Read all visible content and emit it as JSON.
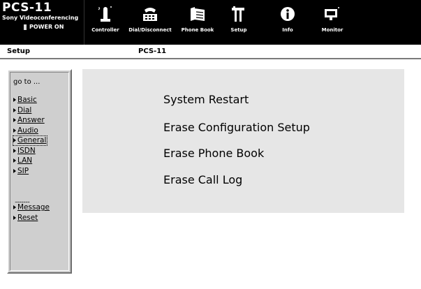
{
  "header": {
    "brand_title": "PCS-11",
    "brand_subtitle": "Sony Videoconferencing",
    "power_status": "POWER ON",
    "nav": [
      {
        "label": "Controller",
        "icon": "controller-icon"
      },
      {
        "label": "Dial/Disconnect",
        "icon": "dial-disconnect-icon"
      },
      {
        "label": "Phone Book",
        "icon": "phone-book-icon"
      },
      {
        "label": "Setup",
        "icon": "setup-icon"
      },
      {
        "label": "Info",
        "icon": "info-icon"
      },
      {
        "label": "Monitor",
        "icon": "monitor-icon"
      }
    ]
  },
  "titlebar": {
    "page_title": "Setup",
    "device_name": "PCS-11"
  },
  "menu": {
    "goto_label": "go to ...",
    "items": [
      {
        "label": "Basic"
      },
      {
        "label": "Dial"
      },
      {
        "label": "Answer"
      },
      {
        "label": "Audio"
      },
      {
        "label": "General"
      },
      {
        "label": "ISDN"
      },
      {
        "label": "LAN"
      },
      {
        "label": "SIP"
      }
    ],
    "separator": "..............",
    "items2": [
      {
        "label": "Message"
      },
      {
        "label": "Reset"
      }
    ]
  },
  "actions": [
    {
      "label": "System Restart"
    },
    {
      "label": "Erase Configuration Setup"
    },
    {
      "label": "Erase Phone Book"
    },
    {
      "label": "Erase Call Log"
    }
  ],
  "colors": {
    "header_bg": "#000000",
    "panel_bg": "#e6e6e6",
    "menu_bg": "#cfcfcf"
  }
}
